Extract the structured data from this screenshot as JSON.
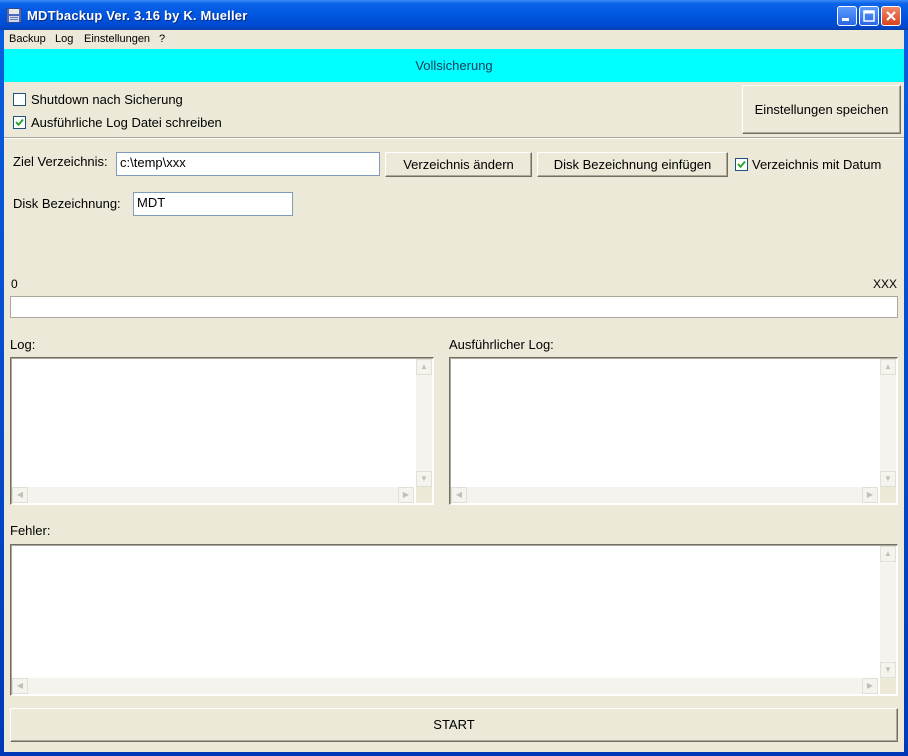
{
  "window": {
    "title": "MDTbackup Ver. 3.16 by K. Mueller",
    "icon": "floppy-disk-icon",
    "controls": [
      "minimize-icon",
      "maximize-icon",
      "close-icon"
    ]
  },
  "menu": [
    "Backup",
    "Log",
    "Einstellungen",
    "?"
  ],
  "banner": {
    "text": "Vollsicherung",
    "color": "#00ffff"
  },
  "options": {
    "shutdown": {
      "label": "Shutdown nach Sicherung",
      "checked": false
    },
    "verbose_log": {
      "label": "Ausführliche Log Datei schreiben",
      "checked": true
    },
    "save_settings_label": "Einstellungen speichen"
  },
  "target": {
    "label": "Ziel Verzeichnis:",
    "value": "c:\\temp\\xxx",
    "change_label": "Verzeichnis ändern",
    "insert_disk_label": "Disk Bezeichnung einfügen",
    "with_date": {
      "label": "Verzeichnis mit Datum",
      "checked": true
    }
  },
  "disk": {
    "label": "Disk Bezeichnung:",
    "value": "MDT"
  },
  "progress": {
    "min_label": "0",
    "max_label": "XXX",
    "value": 0
  },
  "logs": {
    "log_label": "Log:",
    "verbose_label": "Ausführlicher Log:",
    "errors_label": "Fehler:"
  },
  "start_label": "START"
}
